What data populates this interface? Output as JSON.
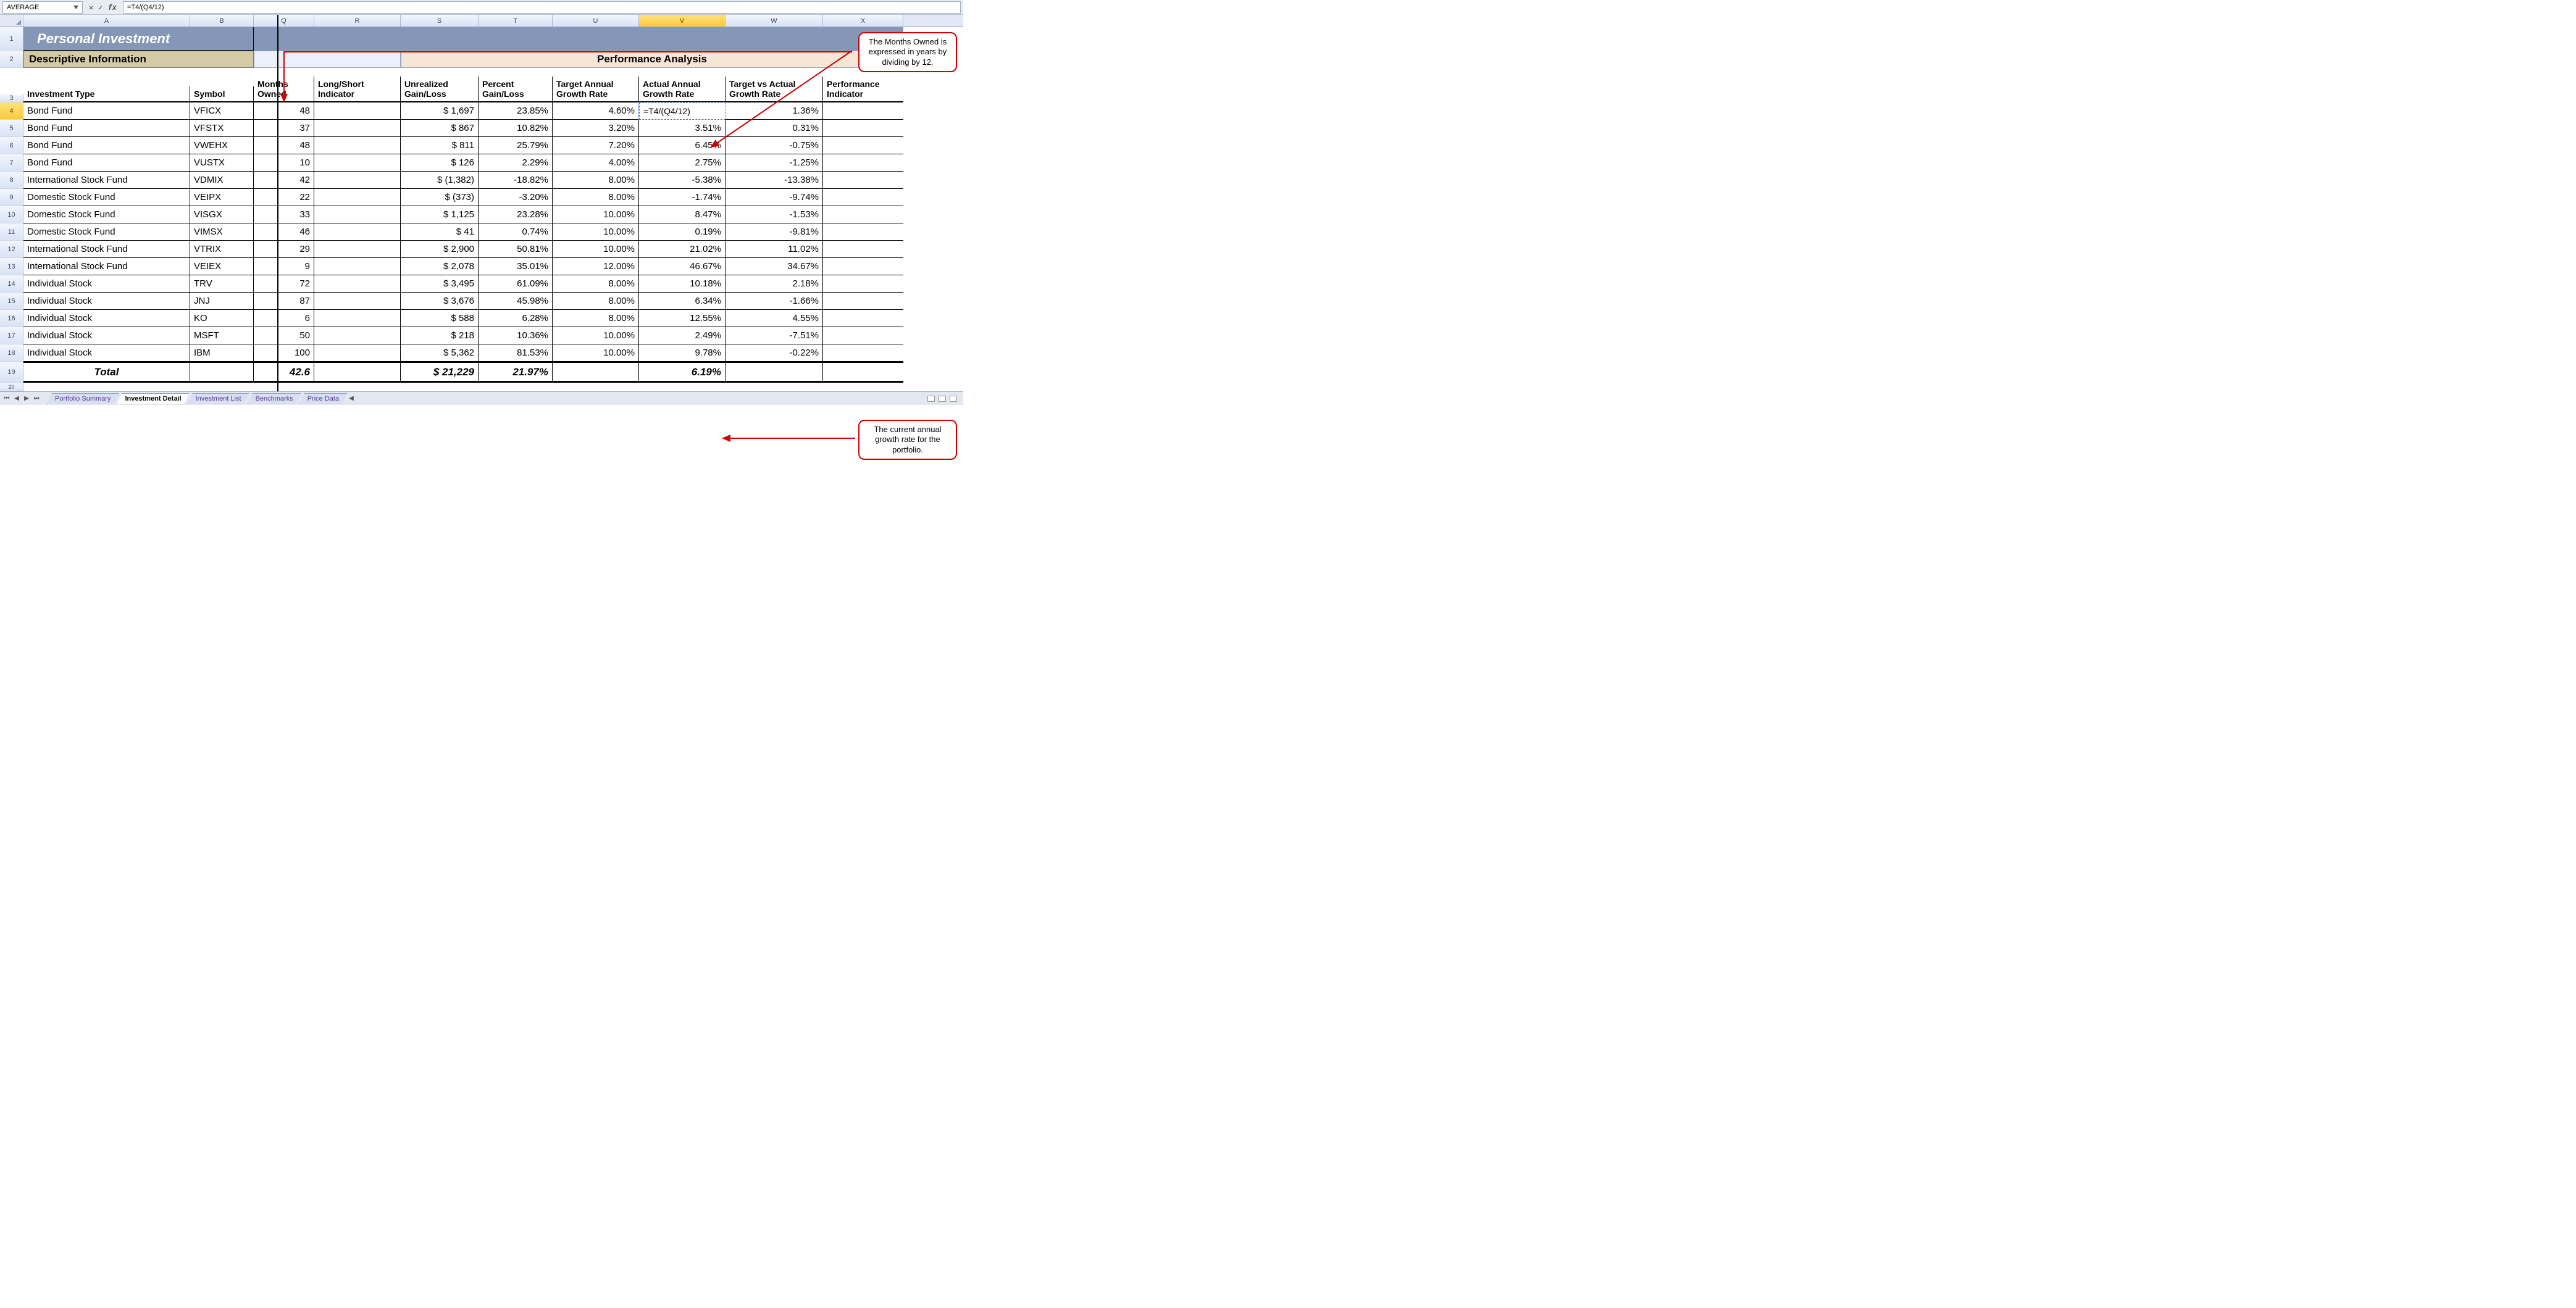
{
  "nameBox": "AVERAGE",
  "formula": "=T4/(Q4/12)",
  "columns": [
    "A",
    "B",
    "Q",
    "R",
    "S",
    "T",
    "U",
    "V",
    "W",
    "X"
  ],
  "activeCol": "V",
  "activeRow": 4,
  "banner": "Personal Investment",
  "section": {
    "desc": "Descriptive Information",
    "perf": "Performance Analysis"
  },
  "labels": {
    "A": "Investment Type",
    "B": "Symbol",
    "Q": "Months Owned",
    "R": "Long/Short Indicator",
    "S": "Unrealized Gain/Loss",
    "T": "Percent Gain/Loss",
    "U": "Target Annual Growth Rate",
    "V": "Actual Annual Growth Rate",
    "W": "Target vs Actual Growth Rate",
    "X": "Performance Indicator"
  },
  "rows": [
    {
      "n": 4,
      "A": "Bond Fund",
      "B": "VFICX",
      "Q": "48",
      "S": "$   1,697",
      "T": "23.85%",
      "U": "4.60%",
      "V": "=T4/(Q4/12)",
      "W": "1.36%"
    },
    {
      "n": 5,
      "A": "Bond Fund",
      "B": "VFSTX",
      "Q": "37",
      "S": "$      867",
      "T": "10.82%",
      "U": "3.20%",
      "V": "3.51%",
      "W": "0.31%"
    },
    {
      "n": 6,
      "A": "Bond Fund",
      "B": "VWEHX",
      "Q": "48",
      "S": "$      811",
      "T": "25.79%",
      "U": "7.20%",
      "V": "6.45%",
      "W": "-0.75%"
    },
    {
      "n": 7,
      "A": "Bond Fund",
      "B": "VUSTX",
      "Q": "10",
      "S": "$      126",
      "T": "2.29%",
      "U": "4.00%",
      "V": "2.75%",
      "W": "-1.25%"
    },
    {
      "n": 8,
      "A": "International Stock Fund",
      "B": "VDMIX",
      "Q": "42",
      "S": "$  (1,382)",
      "T": "-18.82%",
      "U": "8.00%",
      "V": "-5.38%",
      "W": "-13.38%"
    },
    {
      "n": 9,
      "A": "Domestic Stock Fund",
      "B": "VEIPX",
      "Q": "22",
      "S": "$     (373)",
      "T": "-3.20%",
      "U": "8.00%",
      "V": "-1.74%",
      "W": "-9.74%"
    },
    {
      "n": 10,
      "A": "Domestic Stock Fund",
      "B": "VISGX",
      "Q": "33",
      "S": "$   1,125",
      "T": "23.28%",
      "U": "10.00%",
      "V": "8.47%",
      "W": "-1.53%"
    },
    {
      "n": 11,
      "A": "Domestic Stock Fund",
      "B": "VIMSX",
      "Q": "46",
      "S": "$        41",
      "T": "0.74%",
      "U": "10.00%",
      "V": "0.19%",
      "W": "-9.81%"
    },
    {
      "n": 12,
      "A": "International Stock Fund",
      "B": "VTRIX",
      "Q": "29",
      "S": "$   2,900",
      "T": "50.81%",
      "U": "10.00%",
      "V": "21.02%",
      "W": "11.02%"
    },
    {
      "n": 13,
      "A": "International Stock Fund",
      "B": "VEIEX",
      "Q": "9",
      "S": "$   2,078",
      "T": "35.01%",
      "U": "12.00%",
      "V": "46.67%",
      "W": "34.67%"
    },
    {
      "n": 14,
      "A": "Individual Stock",
      "B": "TRV",
      "Q": "72",
      "S": "$   3,495",
      "T": "61.09%",
      "U": "8.00%",
      "V": "10.18%",
      "W": "2.18%"
    },
    {
      "n": 15,
      "A": "Individual Stock",
      "B": "JNJ",
      "Q": "87",
      "S": "$   3,676",
      "T": "45.98%",
      "U": "8.00%",
      "V": "6.34%",
      "W": "-1.66%"
    },
    {
      "n": 16,
      "A": "Individual Stock",
      "B": "KO",
      "Q": "6",
      "S": "$      588",
      "T": "6.28%",
      "U": "8.00%",
      "V": "12.55%",
      "W": "4.55%"
    },
    {
      "n": 17,
      "A": "Individual Stock",
      "B": "MSFT",
      "Q": "50",
      "S": "$      218",
      "T": "10.36%",
      "U": "10.00%",
      "V": "2.49%",
      "W": "-7.51%"
    },
    {
      "n": 18,
      "A": "Individual Stock",
      "B": "IBM",
      "Q": "100",
      "S": "$   5,362",
      "T": "81.53%",
      "U": "10.00%",
      "V": "9.78%",
      "W": "-0.22%"
    }
  ],
  "total": {
    "label": "Total",
    "Q": "42.6",
    "S": "$ 21,229",
    "T": "21.97%",
    "V": "6.19%"
  },
  "tabs": [
    "Portfolio Summary",
    "Investment Detail",
    "Investment List",
    "Benchmarks",
    "Price Data"
  ],
  "activeTab": 1,
  "callout1": "The Months Owned is expressed in years by dividing by 12.",
  "callout2": "The current annual growth rate for the portfolio.",
  "rownums": {
    "r19": "19",
    "r20": "20"
  }
}
